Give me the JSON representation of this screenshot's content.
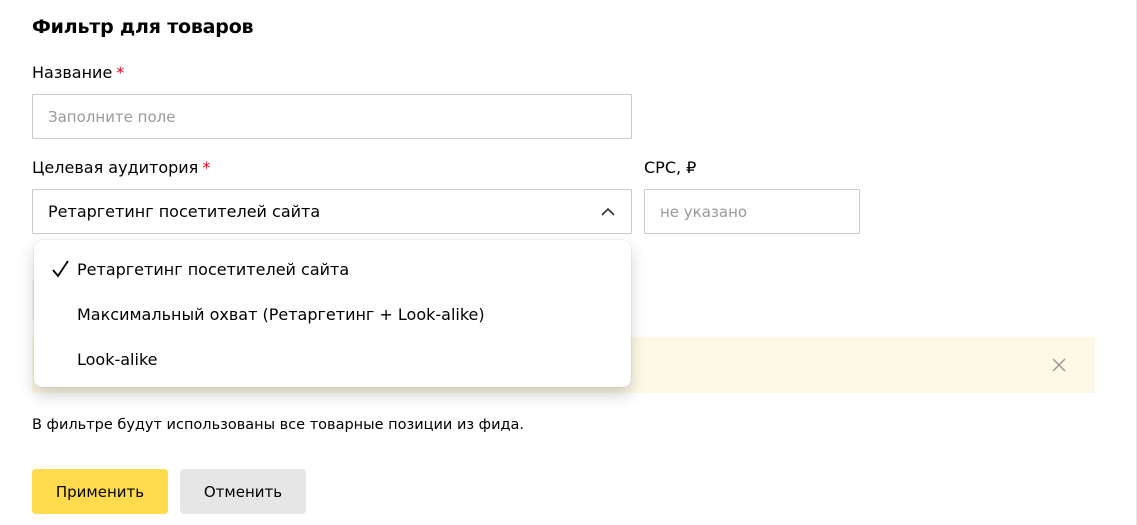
{
  "form": {
    "title": "Фильтр для товаров",
    "name_label": "Название",
    "required_mark": "*",
    "name_placeholder": "Заполните поле",
    "audience_label": "Целевая аудитория",
    "audience_value": "Ретаргетинг посетителей сайта",
    "cpc_label": "CPC, ₽",
    "cpc_placeholder": "не указано",
    "info_text": "В фильтре будут использованы все товарные позиции из фида.",
    "apply_label": "Применить",
    "cancel_label": "Отменить"
  },
  "dropdown": {
    "options": [
      {
        "label": "Ретаргетинг посетителей сайта",
        "selected": true
      },
      {
        "label": "Максимальный охват (Ретаргетинг + Look-alike)",
        "selected": false
      },
      {
        "label": "Look-alike",
        "selected": false
      }
    ]
  },
  "icons": {
    "chevron": "chevron-up-icon",
    "check": "check-icon",
    "close": "close-icon"
  },
  "colors": {
    "required": "#e5001b",
    "apply_button": "#ffdb4d",
    "cancel_button": "#e6e6e6",
    "warning_background": "#fef9e6"
  }
}
